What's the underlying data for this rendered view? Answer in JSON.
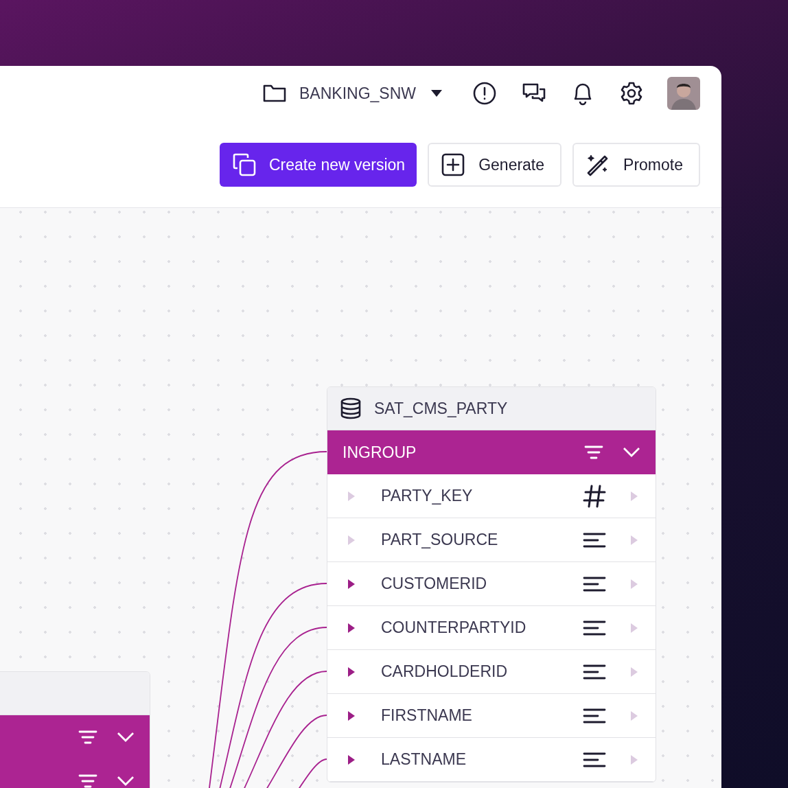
{
  "toolbar": {
    "project": "BANKING_SNW"
  },
  "actions": [
    {
      "label": "Create new version",
      "kind": "copy"
    },
    {
      "label": "Generate",
      "kind": "plus"
    },
    {
      "label": "Promote",
      "kind": "wand"
    }
  ],
  "table": {
    "name": "SAT_CMS_PARTY",
    "group": {
      "label": "INGROUP",
      "expanded": true
    },
    "columns": [
      {
        "name": "PARTY_KEY",
        "kind": "number",
        "linked": false
      },
      {
        "name": "PART_SOURCE",
        "kind": "text",
        "linked": false
      },
      {
        "name": "CUSTOMERID",
        "kind": "text",
        "linked": true
      },
      {
        "name": "COUNTERPARTYID",
        "kind": "text",
        "linked": true
      },
      {
        "name": "CARDHOLDERID",
        "kind": "text",
        "linked": true
      },
      {
        "name": "FIRSTNAME",
        "kind": "text",
        "linked": true
      },
      {
        "name": "LASTNAME",
        "kind": "text",
        "linked": true
      }
    ]
  },
  "left_table": {
    "groups": [
      {
        "expanded": true
      },
      {
        "expanded": true
      }
    ]
  }
}
